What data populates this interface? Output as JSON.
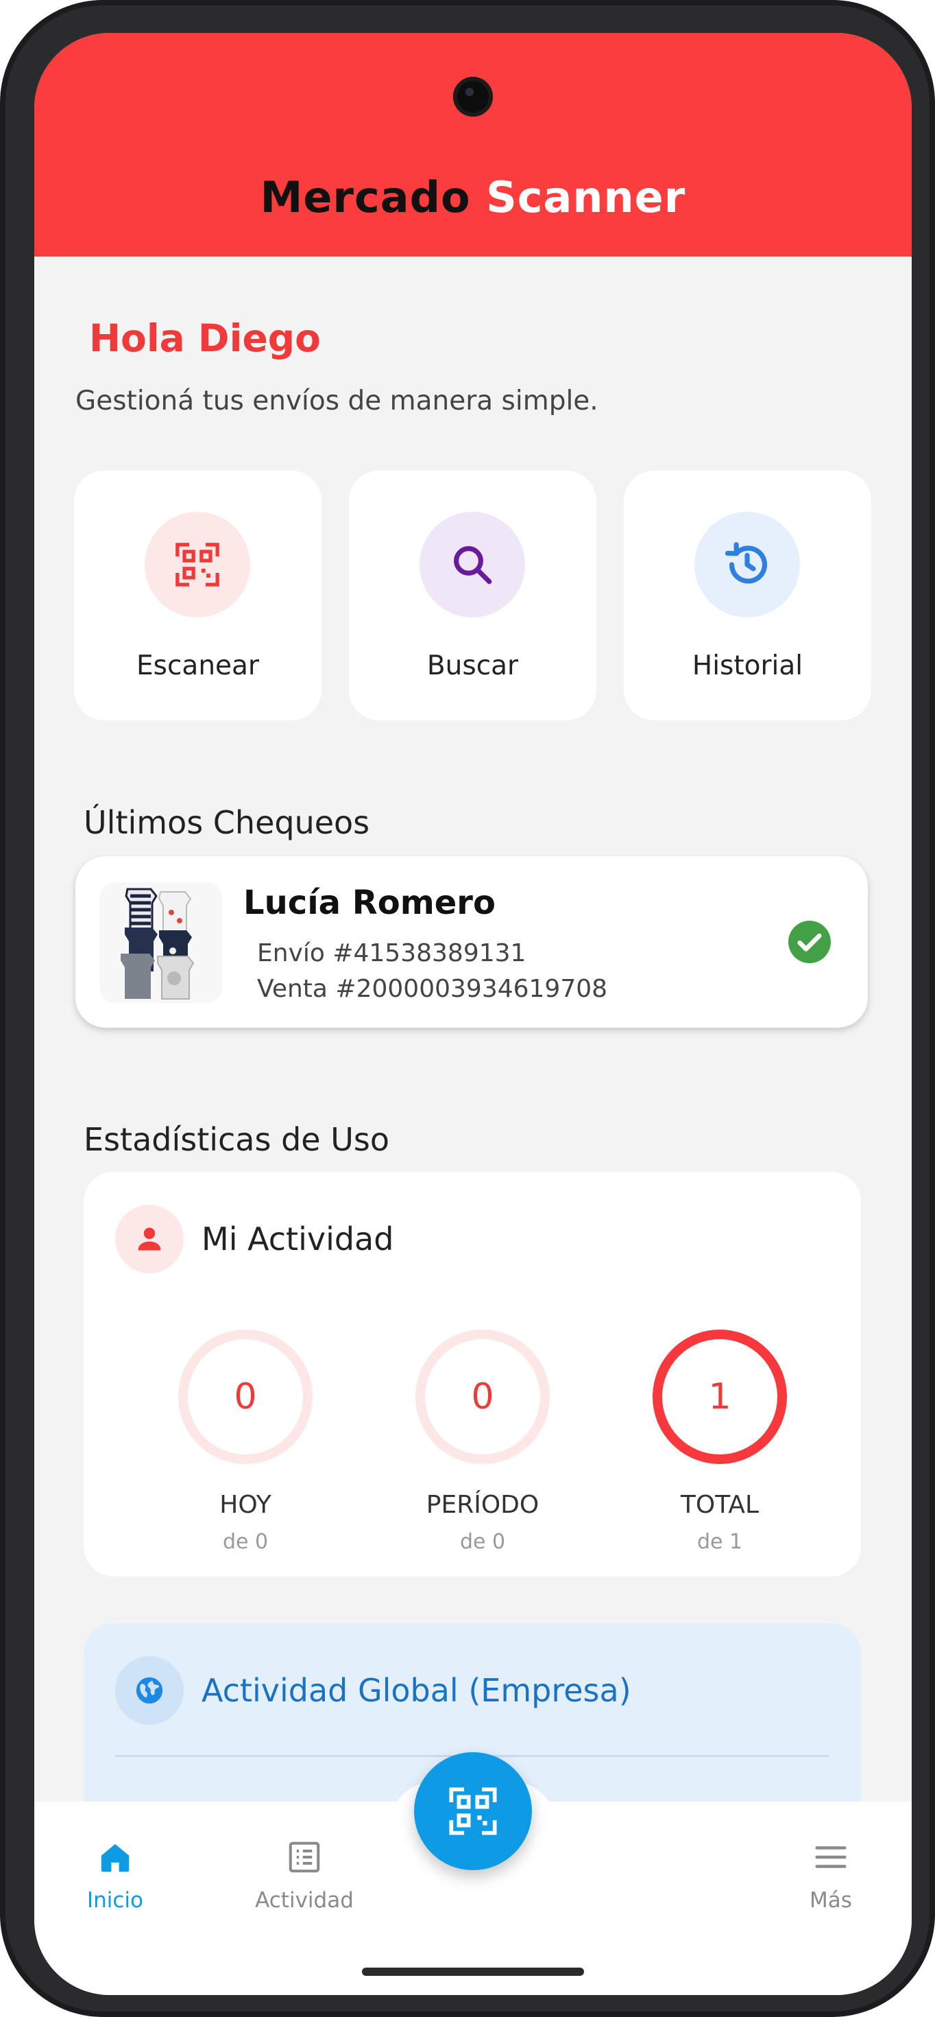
{
  "header": {
    "title_part1": "Mercado",
    "title_part2": "Scanner"
  },
  "greeting": {
    "title": "Hola Diego",
    "subtitle": "Gestioná tus envíos de manera simple."
  },
  "quick_actions": [
    {
      "label": "Escanear",
      "icon": "qr-scan-icon",
      "color": "#f03a3a",
      "bg": "#fde8e8"
    },
    {
      "label": "Buscar",
      "icon": "search-icon",
      "color": "#6a1b9a",
      "bg": "#efe6f7"
    },
    {
      "label": "Historial",
      "icon": "history-icon",
      "color": "#2f7fe0",
      "bg": "#e6f0fd"
    }
  ],
  "recent": {
    "section_title": "Últimos Chequeos",
    "item": {
      "name": "Lucía Romero",
      "shipment": "Envío #41538389131",
      "sale": "Venta #2000003934619708",
      "status_icon": "check-circle-icon",
      "status_color": "#43a047"
    }
  },
  "stats": {
    "section_title": "Estadísticas de Uso",
    "card_title": "Mi Actividad",
    "card_icon": "person-icon",
    "items": [
      {
        "value": "0",
        "label": "HOY",
        "sub": "de 0",
        "progress": 0
      },
      {
        "value": "0",
        "label": "PERÍODO",
        "sub": "de 0",
        "progress": 0
      },
      {
        "value": "1",
        "label": "TOTAL",
        "sub": "de 1",
        "progress": 1
      }
    ]
  },
  "global": {
    "title": "Actividad Global (Empresa)",
    "icon": "globe-icon"
  },
  "nav": {
    "items": [
      {
        "label": "Inicio",
        "icon": "home-icon",
        "active": true
      },
      {
        "label": "Actividad",
        "icon": "list-icon",
        "active": false
      },
      {
        "label": "Más",
        "icon": "menu-icon",
        "active": false
      }
    ],
    "fab_icon": "qr-scan-icon",
    "active_color": "#0d9be6",
    "inactive_color": "#8a8a8a"
  },
  "colors": {
    "brand_red": "#fc3d3d",
    "accent_blue": "#0d9be6"
  }
}
